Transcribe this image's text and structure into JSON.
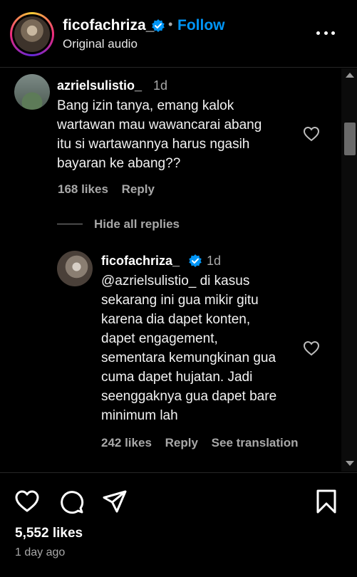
{
  "header": {
    "owner": "ficofachriza_",
    "separator": "•",
    "follow_label": "Follow",
    "audio_label": "Original audio"
  },
  "comments": [
    {
      "username": "azrielsulistio_",
      "time": "1d",
      "text_lines": [
        "Bang izin tanya, emang kalok",
        "wartawan mau wawancarai abang",
        "itu si wartawannya harus ngasih",
        "bayaran ke abang??"
      ],
      "likes": "168 likes",
      "reply_label": "Reply"
    }
  ],
  "hide_replies_label": "Hide all replies",
  "replies": [
    {
      "username": "ficofachriza_",
      "verified": true,
      "time": "1d",
      "text_lines": [
        "@azrielsulistio_ di kasus",
        "sekarang ini gua mikir gitu",
        "karena dia dapet konten,",
        "dapet engagement,",
        "sementara kemungkinan gua",
        "cuma dapet hujatan. Jadi",
        "seenggaknya gua dapet bare",
        "minimum lah"
      ],
      "likes": "242 likes",
      "reply_label": "Reply",
      "translation_label": "See translation"
    }
  ],
  "post": {
    "likes": "5,552 likes",
    "date": "1 day ago"
  },
  "icons": {
    "verified_color": "#0095f6",
    "follow_color": "#0095f6"
  }
}
